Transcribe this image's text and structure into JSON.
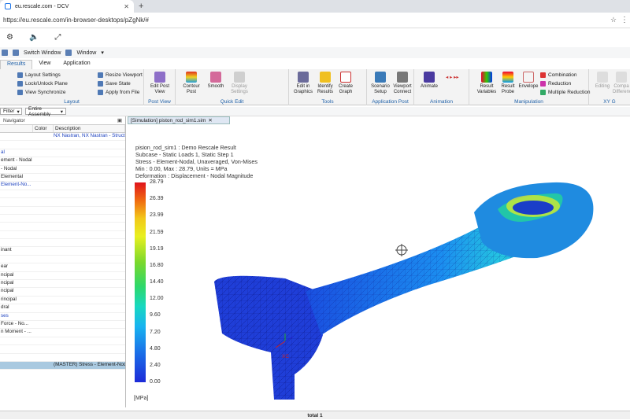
{
  "browser": {
    "tab_title": "eu.rescale.com - DCV",
    "url": "https://eu.rescale.com/in-browser-desktops/pZgNk/#"
  },
  "dcv": {
    "switch_window": "Switch Window",
    "window_menu": "Window"
  },
  "ribbon": {
    "tabs": [
      "Results",
      "View",
      "Application"
    ],
    "layout": {
      "label": "Layout",
      "items": [
        "Layout Settings",
        "Lock/Unlock Plane",
        "View Synchronize",
        "Resize Viewport",
        "Save State",
        "Apply from File"
      ]
    },
    "post_view": {
      "label": "Post View",
      "items": [
        "Edit Post View"
      ]
    },
    "quick_edit": {
      "label": "Quick Edit",
      "items": [
        "Contour Post",
        "Smooth",
        "Display Settings"
      ]
    },
    "tools": {
      "label": "Tools",
      "items": [
        "Edit in Graphics",
        "Identify Results",
        "Create Graph"
      ]
    },
    "application_post": {
      "label": "Application Post",
      "items": [
        "Scenario Setup",
        "Viewport Connect"
      ]
    },
    "animation": {
      "label": "Animation",
      "items": [
        "Animate"
      ]
    },
    "manipulation": {
      "label": "Manipulation",
      "items": [
        "Result Variables",
        "Result Probe",
        "Envelope",
        "Combination",
        "Reduction",
        "Multiple Reduction"
      ]
    },
    "xy_graph": {
      "label": "XY G",
      "items": [
        "Editing",
        "Compa Difference"
      ]
    }
  },
  "selection": {
    "filter": "Filter",
    "assembly": "Entire Assembly"
  },
  "navigator": {
    "title": "Navigator",
    "columns": [
      "",
      "Color",
      "Description"
    ],
    "rows": [
      {
        "c1": "",
        "c3": "NX Nastran, NX Nastran - Structu",
        "blue": true
      },
      {
        "c1": "",
        "c3": ""
      },
      {
        "c1": "al",
        "c3": "",
        "blue": true
      },
      {
        "c1": "ement - Nodal",
        "c3": ""
      },
      {
        "c1": "- Nodal",
        "c3": ""
      },
      {
        "c1": "Elemental",
        "c3": ""
      },
      {
        "c1": "Element-No...",
        "c3": "",
        "blue": true
      },
      {
        "c1": "",
        "c3": ""
      },
      {
        "c1": "",
        "c3": ""
      },
      {
        "c1": "",
        "c3": ""
      },
      {
        "c1": "",
        "c3": ""
      },
      {
        "c1": "",
        "c3": ""
      },
      {
        "c1": "",
        "c3": ""
      },
      {
        "c1": "",
        "c3": ""
      },
      {
        "c1": "inant",
        "c3": ""
      },
      {
        "c1": "",
        "c3": ""
      },
      {
        "c1": "ear",
        "c3": ""
      },
      {
        "c1": "ncipal",
        "c3": ""
      },
      {
        "c1": "ncipal",
        "c3": ""
      },
      {
        "c1": "ncipal",
        "c3": ""
      },
      {
        "c1": "rincipal",
        "c3": ""
      },
      {
        "c1": "dral",
        "c3": ""
      },
      {
        "c1": "ses",
        "c3": "",
        "blue": true
      },
      {
        "c1": "Force - No...",
        "c3": ""
      },
      {
        "c1": "n Moment - ...",
        "c3": ""
      },
      {
        "c1": "",
        "c3": ""
      },
      {
        "c1": "",
        "c3": ""
      },
      {
        "c1": "",
        "c3": ""
      },
      {
        "c1": "",
        "c3": "(MASTER) Stress - Element-Nodal",
        "hl": true
      }
    ]
  },
  "viewport": {
    "tab": "[Simulation] piston_rod_sim1.sim",
    "info": [
      "pision_rod_sim1 : Demo Rescale Result",
      "Subcase - Static Loads 1, Static Step 1",
      "Stress - Element-Nodal, Unaveraged, Von-Mises",
      "Min : 0.00, Max : 28.79, Units = MPa",
      "Deformation : Displacement - Nodal Magnitude"
    ],
    "legend": [
      "28.79",
      "26.39",
      "23.99",
      "21.59",
      "19.19",
      "16.80",
      "14.40",
      "12.00",
      "9.60",
      "7.20",
      "4.80",
      "2.40",
      "0.00"
    ],
    "unit": "[MPa]",
    "axes": {
      "xc": "XC"
    }
  },
  "status": "total 1"
}
